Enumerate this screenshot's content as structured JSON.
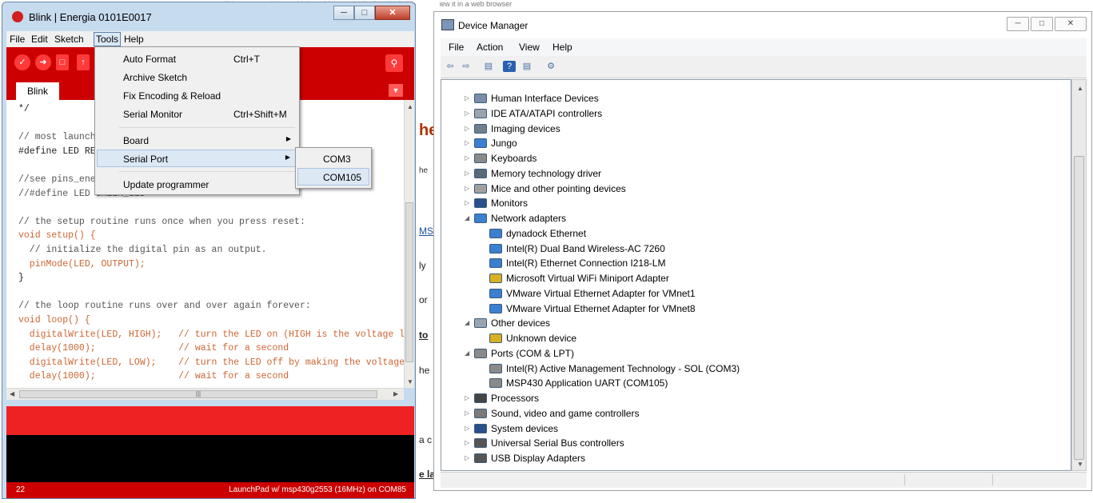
{
  "background_page": {
    "top_snippet": "If there are problems with how this page is displayed, click here to view it in a web browser",
    "fragments": [
      "he",
      "he",
      "MS",
      "ly",
      "or",
      "to",
      "he",
      "a c",
      "e la"
    ]
  },
  "energia": {
    "title": "Blink | Energia 0101E0017",
    "menu": [
      "File",
      "Edit",
      "Sketch",
      "Tools",
      "Help"
    ],
    "tab_label": "Blink",
    "code_lines": [
      "*/",
      "",
      "// most launchpads have a red LED",
      "#define LED RED_LED",
      "",
      "//see pins_energia.h for more LED definitions",
      "//#define LED GREEN_LED",
      "",
      "// the setup routine runs once when you press reset:",
      "void setup() {",
      "  // initialize the digital pin as an output.",
      "  pinMode(LED, OUTPUT);",
      "}",
      "",
      "// the loop routine runs over and over again forever:",
      "void loop() {",
      "  digitalWrite(LED, HIGH);   // turn the LED on (HIGH is the voltage level)",
      "  delay(1000);               // wait for a second",
      "  digitalWrite(LED, LOW);    // turn the LED off by making the voltage LOW",
      "  delay(1000);               // wait for a second"
    ],
    "status": {
      "line_number": "22",
      "board": "LaunchPad w/ msp430g2553 (16MHz) on COM85"
    }
  },
  "tools_menu": {
    "items": [
      {
        "label": "Auto Format",
        "shortcut": "Ctrl+T"
      },
      {
        "label": "Archive Sketch",
        "shortcut": ""
      },
      {
        "label": "Fix Encoding & Reload",
        "shortcut": ""
      },
      {
        "label": "Serial Monitor",
        "shortcut": "Ctrl+Shift+M"
      },
      {
        "label": "Board",
        "shortcut": ""
      },
      {
        "label": "Serial Port",
        "shortcut": ""
      },
      {
        "label": "Update programmer",
        "shortcut": ""
      }
    ],
    "serial_ports": [
      "COM3",
      "COM105"
    ]
  },
  "device_manager": {
    "title": "Device Manager",
    "menu": [
      "File",
      "Action",
      "View",
      "Help"
    ],
    "tree": [
      {
        "label": "Human Interface Devices",
        "level": 0,
        "expanded": false,
        "icon_color": "#7a8ea8"
      },
      {
        "label": "IDE ATA/ATAPI controllers",
        "level": 0,
        "expanded": false,
        "icon_color": "#9aa4ae"
      },
      {
        "label": "Imaging devices",
        "level": 0,
        "expanded": false,
        "icon_color": "#6f7f90"
      },
      {
        "label": "Jungo",
        "level": 0,
        "expanded": false,
        "icon_color": "#3b7fd1"
      },
      {
        "label": "Keyboards",
        "level": 0,
        "expanded": false,
        "icon_color": "#8a8a8a"
      },
      {
        "label": "Memory technology driver",
        "level": 0,
        "expanded": false,
        "icon_color": "#5a6a7a"
      },
      {
        "label": "Mice and other pointing devices",
        "level": 0,
        "expanded": false,
        "icon_color": "#a0a0a0"
      },
      {
        "label": "Monitors",
        "level": 0,
        "expanded": false,
        "icon_color": "#2a4f8a"
      },
      {
        "label": "Network adapters",
        "level": 0,
        "expanded": true,
        "icon_color": "#3b7fd1"
      },
      {
        "label": "dynadock Ethernet",
        "level": 1,
        "expanded": false,
        "icon_color": "#3b7fd1"
      },
      {
        "label": "Intel(R) Dual Band Wireless-AC 7260",
        "level": 1,
        "expanded": false,
        "icon_color": "#3b7fd1"
      },
      {
        "label": "Intel(R) Ethernet Connection I218-LM",
        "level": 1,
        "expanded": false,
        "icon_color": "#3b7fd1"
      },
      {
        "label": "Microsoft Virtual WiFi Miniport Adapter",
        "level": 1,
        "expanded": false,
        "icon_color": "#d8b020"
      },
      {
        "label": "VMware Virtual Ethernet Adapter for VMnet1",
        "level": 1,
        "expanded": false,
        "icon_color": "#3b7fd1"
      },
      {
        "label": "VMware Virtual Ethernet Adapter for VMnet8",
        "level": 1,
        "expanded": false,
        "icon_color": "#3b7fd1"
      },
      {
        "label": "Other devices",
        "level": 0,
        "expanded": true,
        "icon_color": "#9aa4ae"
      },
      {
        "label": "Unknown device",
        "level": 1,
        "expanded": false,
        "icon_color": "#d8b020"
      },
      {
        "label": "Ports (COM & LPT)",
        "level": 0,
        "expanded": true,
        "icon_color": "#8a8a8a"
      },
      {
        "label": "Intel(R) Active Management Technology - SOL (COM3)",
        "level": 1,
        "expanded": false,
        "icon_color": "#8a8a8a"
      },
      {
        "label": "MSP430 Application UART (COM105)",
        "level": 1,
        "expanded": false,
        "icon_color": "#8a8a8a"
      },
      {
        "label": "Processors",
        "level": 0,
        "expanded": false,
        "icon_color": "#444444"
      },
      {
        "label": "Sound, video and game controllers",
        "level": 0,
        "expanded": false,
        "icon_color": "#7a7a7a"
      },
      {
        "label": "System devices",
        "level": 0,
        "expanded": false,
        "icon_color": "#2a4f8a"
      },
      {
        "label": "Universal Serial Bus controllers",
        "level": 0,
        "expanded": false,
        "icon_color": "#555555"
      },
      {
        "label": "USB Display Adapters",
        "level": 0,
        "expanded": false,
        "icon_color": "#555555"
      }
    ]
  },
  "colors": {
    "energia_red": "#cc0000",
    "energia_message_red": "#ee2222",
    "menu_highlight": "#dde8f5"
  }
}
